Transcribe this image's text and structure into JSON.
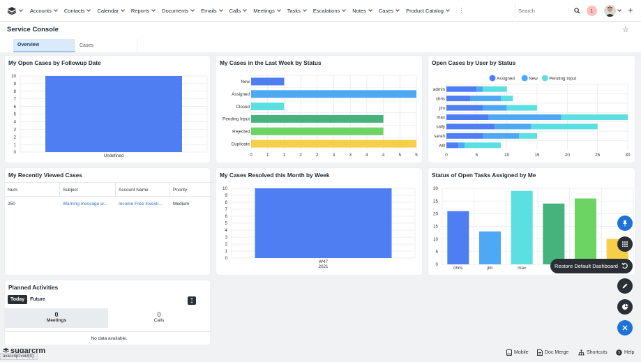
{
  "nav": {
    "items": [
      "Accounts",
      "Contacts",
      "Calendar",
      "Reports",
      "Documents",
      "Emails",
      "Calls",
      "Meetings",
      "Tasks",
      "Escalations",
      "Notes",
      "Cases",
      "Product Catalog"
    ],
    "more": "⋮",
    "search_placeholder": "Search",
    "notification_count": "1"
  },
  "page": {
    "title": "Service Console",
    "tabs": [
      "Overview",
      "Cases"
    ]
  },
  "dashlets": {
    "followup": {
      "title": "My Open Cases by Followup Date"
    },
    "lastweek": {
      "title": "My Cases in the Last Week by Status"
    },
    "byuser": {
      "title": "Open Cases by User by Status"
    },
    "recent": {
      "title": "My Recently Viewed Cases",
      "columns": [
        "Num.",
        "Subject",
        "Account Name",
        "Priority"
      ],
      "rows": [
        {
          "num": "250",
          "subject": "Warning message w...",
          "account": "Income Free Investi...",
          "priority": "Medium"
        }
      ]
    },
    "resolved": {
      "title": "My Cases Resolved this Month by Week"
    },
    "tasks": {
      "title": "Status of Open Tasks Assigned by Me"
    },
    "planned": {
      "title": "Planned Activities",
      "toggle": [
        "Today",
        "Future"
      ],
      "meetings_count": "0",
      "meetings_label": "Meetings",
      "calls_count": "0",
      "calls_label": "Calls",
      "nodata": "No data available."
    }
  },
  "chart_data": [
    {
      "type": "bar",
      "categories": [
        "Undefined"
      ],
      "values": [
        10
      ],
      "ylim": [
        0,
        10
      ],
      "yticks": [
        0,
        1,
        2,
        3,
        4,
        5,
        6,
        7,
        8,
        9,
        10
      ],
      "color": "#4f7ef2"
    },
    {
      "type": "bar",
      "orientation": "horizontal",
      "categories": [
        "New",
        "Assigned",
        "Closed",
        "Pending Input",
        "Rejected",
        "Duplicate"
      ],
      "values": [
        1,
        5,
        1,
        4,
        4,
        5
      ],
      "colors": [
        "#4f7ef2",
        "#4fa8f4",
        "#5cdfe0",
        "#46b37c",
        "#6bd462",
        "#f5cf47"
      ],
      "xlim": [
        0,
        5
      ],
      "xticks": [
        0,
        0.5,
        1,
        1.5,
        2,
        2.5,
        3,
        3.5,
        4,
        4.5,
        5
      ],
      "xticklabels": [
        "0",
        "1",
        "1",
        "2",
        "2",
        "3",
        "3",
        "4",
        "4",
        "5",
        "5"
      ]
    },
    {
      "type": "bar",
      "orientation": "horizontal",
      "stacked": true,
      "categories": [
        "admin",
        "chris",
        "jim",
        "max",
        "sally",
        "sarah",
        "will"
      ],
      "series": [
        {
          "name": "Assigned",
          "color": "#4f7ef2",
          "values": [
            5,
            4,
            6,
            7,
            8,
            6,
            2
          ]
        },
        {
          "name": "New",
          "color": "#4fa8f4",
          "values": [
            1,
            5,
            4,
            12,
            6,
            6,
            1
          ]
        },
        {
          "name": "Pending Input",
          "color": "#5cdfe0",
          "values": [
            4,
            2,
            5,
            11,
            11,
            3,
            6
          ]
        }
      ],
      "xlim": [
        0,
        30
      ],
      "xticks": [
        0,
        5,
        10,
        15,
        20,
        25,
        30
      ],
      "legend": "top"
    },
    {
      "type": "bar",
      "categories": [
        "W47"
      ],
      "sublabel": "2021",
      "values": [
        10
      ],
      "ylim": [
        0,
        10
      ],
      "yticks": [
        0,
        1,
        2,
        3,
        4,
        5,
        6,
        7,
        8,
        9,
        10
      ],
      "color": "#4f7ef2"
    },
    {
      "type": "bar",
      "categories": [
        "chris",
        "jim",
        "max",
        "sally",
        "sarah",
        "will"
      ],
      "tick_labels": [
        "chris",
        "jim",
        "max",
        "sa",
        "",
        ""
      ],
      "values": [
        21,
        13,
        29,
        24,
        26,
        10
      ],
      "colors": [
        "#4f7ef2",
        "#4fa8f4",
        "#5cdfe0",
        "#46b37c",
        "#6bd462",
        "#f5cf47"
      ],
      "ylim": [
        0,
        30
      ],
      "yticks": [
        0,
        5,
        10,
        15,
        20,
        25,
        30
      ]
    }
  ],
  "fab": {
    "tooltip": "Restore Default Dashboard"
  },
  "footer": {
    "brand": "sugarcrm",
    "status": "avascript:void(0);",
    "mobile": "Mobile",
    "docmerge": "Doc Merge",
    "shortcuts": "Shortcuts",
    "help": "Help"
  }
}
